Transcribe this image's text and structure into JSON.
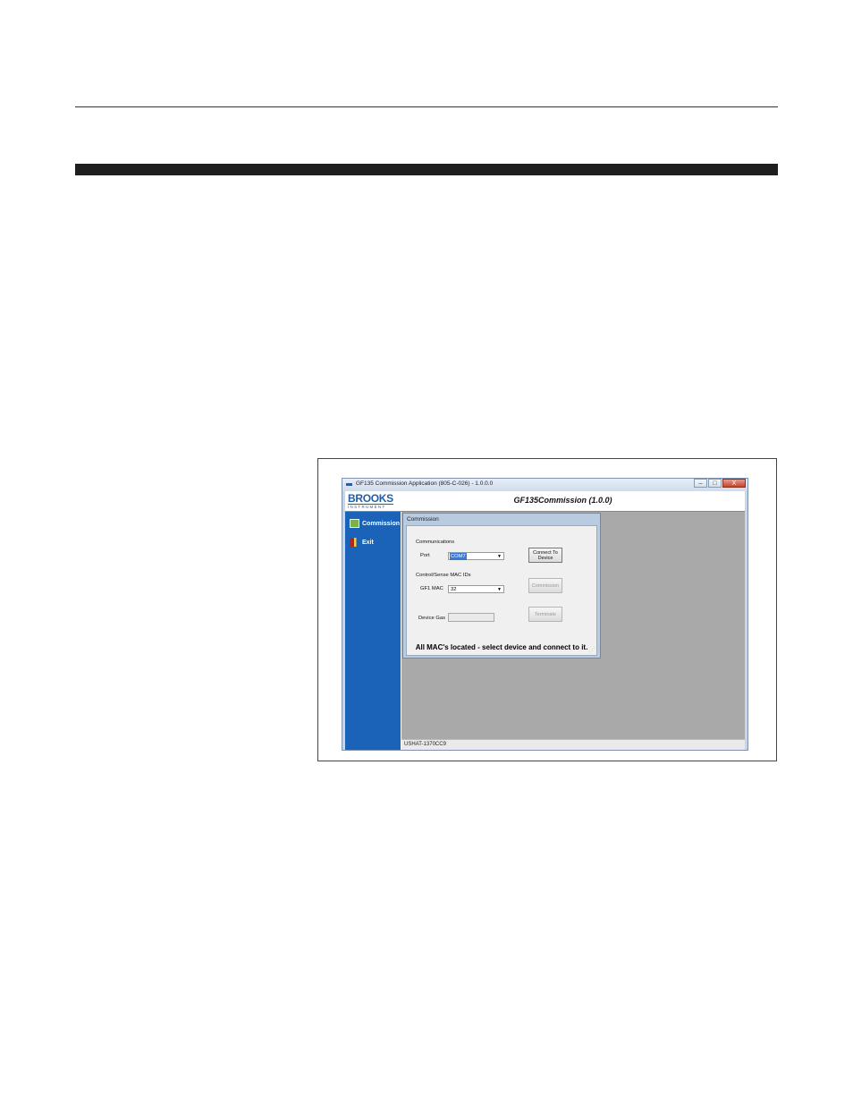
{
  "window": {
    "title": "GF135 Commission Application (805-C-026) - 1.0.0.0",
    "buttons": {
      "minimize": "–",
      "maximize": "□",
      "close": "X"
    }
  },
  "header": {
    "brand": "BROOKS",
    "brand_sub": "INSTRUMENT",
    "app_title": "GF135Commission (1.0.0)"
  },
  "sidebar": {
    "items": [
      {
        "label": "Commission",
        "icon": "commission-icon"
      },
      {
        "label": "Exit",
        "icon": "exit-icon"
      }
    ]
  },
  "commission_panel": {
    "title": "Commission",
    "communications_label": "Communications",
    "port_label": "Port",
    "port_value": "COM7",
    "connect_button": "Connect To Device",
    "mac_group_label": "Control/Sense MAC IDs",
    "gf1mac_label": "GF1 MAC",
    "gf1mac_value": "32",
    "commission_button": "Commission",
    "device_gas_label": "Device Gas",
    "device_gas_value": "",
    "terminate_button": "Terminate",
    "message": "All MAC's located - select device and connect to it."
  },
  "statusbar": {
    "text": "USHAT-1370CC9"
  },
  "colors": {
    "sidebar": "#1a63b8",
    "workarea": "#a9a9a9",
    "brand": "#1f5fa8"
  }
}
